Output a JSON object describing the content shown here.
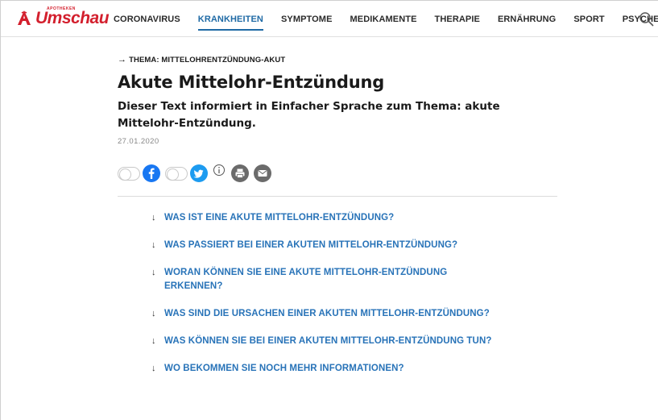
{
  "brand": {
    "name": "Umschau",
    "small_label": "APOTHEKEN",
    "color": "#d31f2d"
  },
  "nav": {
    "items": [
      {
        "label": "CORONAVIRUS"
      },
      {
        "label": "KRANKHEITEN",
        "active": true
      },
      {
        "label": "SYMPTOME"
      },
      {
        "label": "MEDIKAMENTE"
      },
      {
        "label": "THERAPIE"
      },
      {
        "label": "ERNÄHRUNG"
      },
      {
        "label": "SPORT"
      },
      {
        "label": "PSYCHE"
      }
    ],
    "search_icon": "search-icon",
    "active_color": "#1f6aa5"
  },
  "article": {
    "kicker": "THEMA: MITTELOHRENTZÜNDUNG-AKUT",
    "title": "Akute Mittelohr-Entzündung",
    "subtitle": "Dieser Text informiert in Einfacher Sprache zum Thema: akute Mittelohr-Entzündung.",
    "date": "27.01.2020"
  },
  "share": {
    "icons": [
      "toggle-switch",
      "facebook-icon",
      "toggle-switch",
      "twitter-icon",
      "info-icon",
      "print-icon",
      "email-icon"
    ],
    "facebook_color": "#1877f2",
    "twitter_color": "#1d9bf0",
    "gray_color": "#6b6b6b"
  },
  "toc": {
    "link_color": "#2873b8",
    "items": [
      {
        "label": "WAS IST EINE AKUTE MITTELOHR-ENTZÜNDUNG?"
      },
      {
        "label": "WAS PASSIERT BEI EINER AKUTEN MITTELOHR-ENTZÜNDUNG?"
      },
      {
        "label": "WORAN KÖNNEN SIE EINE AKUTE MITTELOHR-ENTZÜNDUNG ERKENNEN?"
      },
      {
        "label": "WAS SIND DIE URSACHEN EINER AKUTEN MITTELOHR-ENTZÜNDUNG?"
      },
      {
        "label": "WAS KÖNNEN SIE BEI EINER AKUTEN MITTELOHR-ENTZÜNDUNG TUN?"
      },
      {
        "label": "WO BEKOMMEN SIE NOCH MEHR INFORMATIONEN?"
      }
    ]
  }
}
